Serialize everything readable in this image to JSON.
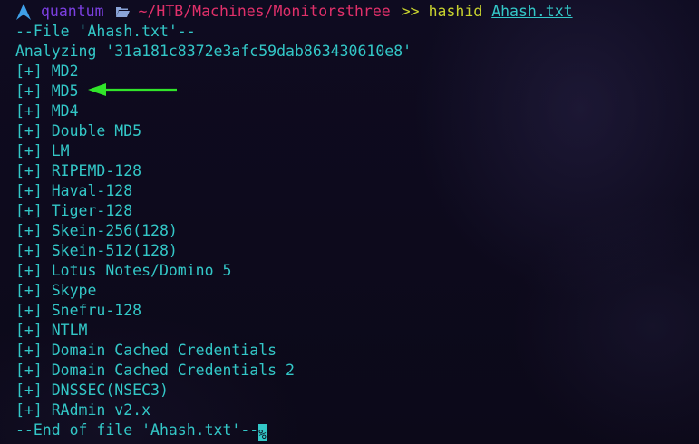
{
  "colors": {
    "background": "#0d0a1c",
    "text": "#33c7c7",
    "user": "#7b3fe0",
    "path": "#e0306a",
    "command": "#c6d02e",
    "arrow": "#31e42a"
  },
  "prompt": {
    "os_icon": "arch-linux-icon",
    "user": "quantum",
    "folder_icon": "folder-open-icon",
    "path": "~/HTB/Machines/Monitorsthree",
    "separator": ">>",
    "command": "hashid",
    "argument": "Ahash.txt"
  },
  "output": {
    "file_header": "--File 'Ahash.txt'--",
    "analyzing": "Analyzing '31a181c8372e3afc59dab863430610e8'",
    "results": [
      "[+] MD2",
      "[+] MD5",
      "[+] MD4",
      "[+] Double MD5",
      "[+] LM",
      "[+] RIPEMD-128",
      "[+] Haval-128",
      "[+] Tiger-128",
      "[+] Skein-256(128)",
      "[+] Skein-512(128)",
      "[+] Lotus Notes/Domino 5",
      "[+] Skype",
      "[+] Snefru-128",
      "[+] NTLM",
      "[+] Domain Cached Credentials",
      "[+] Domain Cached Credentials 2",
      "[+] DNSSEC(NSEC3)",
      "[+] RAdmin v2.x"
    ],
    "file_footer": "--End of file 'Ahash.txt'--",
    "cursor_char": "%"
  },
  "annotation": {
    "icon": "arrow-left-icon",
    "target": "[+] MD5"
  }
}
